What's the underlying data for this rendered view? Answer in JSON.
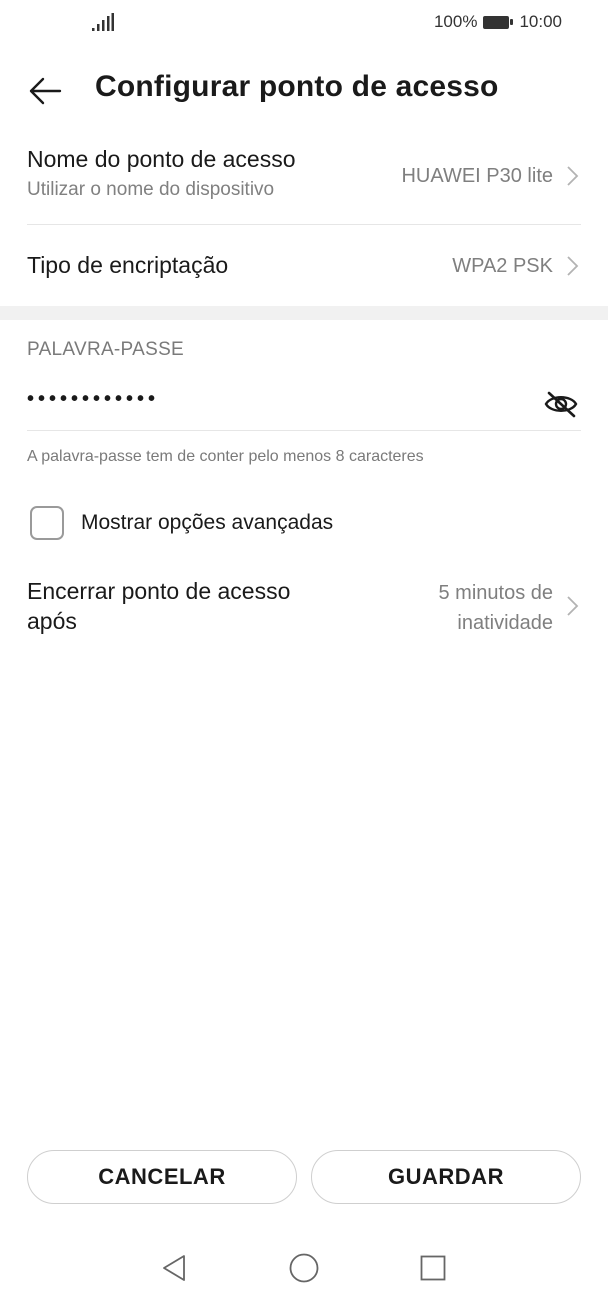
{
  "status_bar": {
    "battery_percent": "100%",
    "time": "10:00"
  },
  "header": {
    "title": "Configurar ponto de acesso"
  },
  "settings": {
    "hotspot_name": {
      "label": "Nome do ponto de acesso",
      "sublabel": "Utilizar o nome do dispositivo",
      "value": "HUAWEI P30 lite"
    },
    "encryption": {
      "label": "Tipo de encriptação",
      "value": "WPA2 PSK"
    },
    "password": {
      "section_label": "PALAVRA-PASSE",
      "masked_value": "••••••••••••",
      "hint": "A palavra-passe tem de conter pelo menos 8 caracteres"
    },
    "advanced": {
      "label": "Mostrar opções avançadas",
      "checked": false
    },
    "shutdown": {
      "label_line1": "Encerrar ponto de acesso",
      "label_line2": "após",
      "value_line1": "5 minutos de",
      "value_line2": "inatividade"
    }
  },
  "buttons": {
    "cancel": "CANCELAR",
    "save": "GUARDAR"
  },
  "icons": {
    "back": "arrow-left-icon",
    "chevron": "chevron-right-icon",
    "eye": "eye-off-icon",
    "nav_back": "triangle-back-icon",
    "nav_home": "circle-home-icon",
    "nav_recent": "square-recent-icon"
  },
  "colors": {
    "text_primary": "#1a1a1a",
    "text_secondary": "#7f7f7f",
    "divider": "#e6e6e6",
    "band": "#f1f1f1"
  }
}
